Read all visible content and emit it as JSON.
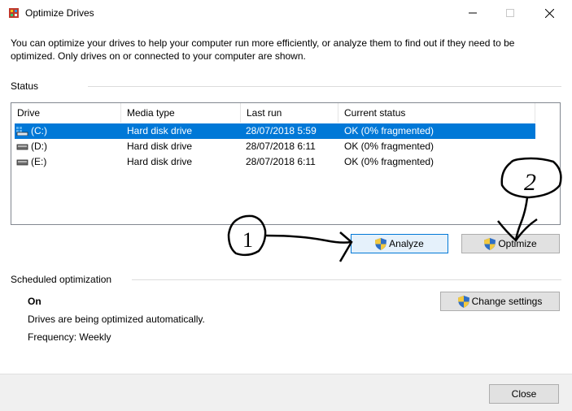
{
  "window": {
    "title": "Optimize Drives",
    "icon": "optimize-drives-app-icon",
    "controls": {
      "minimize": "minimize-icon",
      "maximize": "maximize-icon",
      "close": "close-icon"
    }
  },
  "intro_text": "You can optimize your drives to help your computer run more efficiently, or analyze them to find out if they need to be optimized. Only drives on or connected to your computer are shown.",
  "status": {
    "label": "Status",
    "columns": [
      "Drive",
      "Media type",
      "Last run",
      "Current status"
    ],
    "drives": [
      {
        "drive": "(C:)",
        "media_type": "Hard disk drive",
        "last_run": "28/07/2018 5:59",
        "current_status": "OK (0% fragmented)",
        "selected": true,
        "icon": "system-drive-icon"
      },
      {
        "drive": "(D:)",
        "media_type": "Hard disk drive",
        "last_run": "28/07/2018 6:11",
        "current_status": "OK (0% fragmented)",
        "selected": false,
        "icon": "hard-drive-icon"
      },
      {
        "drive": "(E:)",
        "media_type": "Hard disk drive",
        "last_run": "28/07/2018 6:11",
        "current_status": "OK (0% fragmented)",
        "selected": false,
        "icon": "hard-drive-icon"
      }
    ],
    "analyze_label": "Analyze",
    "optimize_label": "Optimize"
  },
  "scheduled": {
    "label": "Scheduled optimization",
    "state": "On",
    "description": "Drives are being optimized automatically.",
    "frequency": "Frequency: Weekly",
    "change_settings_label": "Change settings"
  },
  "footer": {
    "close_label": "Close"
  },
  "annotations": {
    "first": "1",
    "second": "2"
  },
  "colors": {
    "selection": "#0078d7",
    "button_face": "#e1e1e1",
    "footer_bg": "#f0f0f0",
    "focus_border": "#0078d7"
  }
}
